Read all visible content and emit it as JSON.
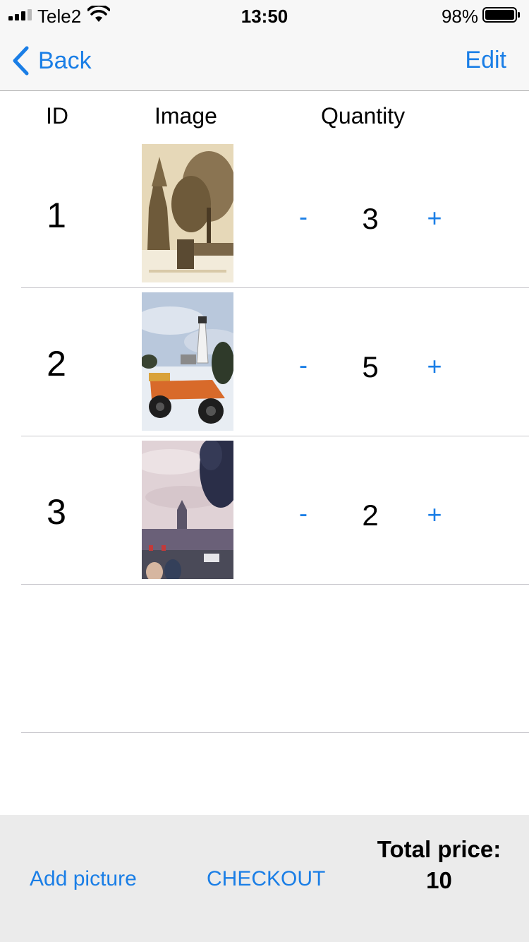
{
  "status_bar": {
    "carrier": "Tele2",
    "time": "13:50",
    "battery": "98%"
  },
  "nav": {
    "back_label": "Back",
    "edit_label": "Edit"
  },
  "table": {
    "columns": [
      "ID",
      "Image",
      "Quantity"
    ],
    "rows": [
      {
        "id": "1",
        "quantity": "3",
        "image": "snowy-trees-sepia-photo"
      },
      {
        "id": "2",
        "quantity": "5",
        "image": "lighthouse-atv-snow-photo"
      },
      {
        "id": "3",
        "quantity": "2",
        "image": "clock-tower-street-photo"
      }
    ],
    "minus_label": "-",
    "plus_label": "+"
  },
  "footer": {
    "add_picture_label": "Add picture",
    "checkout_label": "CHECKOUT",
    "total_label": "Total price:",
    "total_value": "10"
  },
  "colors": {
    "accent": "#1a7ee6",
    "bar_bg": "#f7f7f7",
    "footer_bg": "#ebebeb"
  }
}
